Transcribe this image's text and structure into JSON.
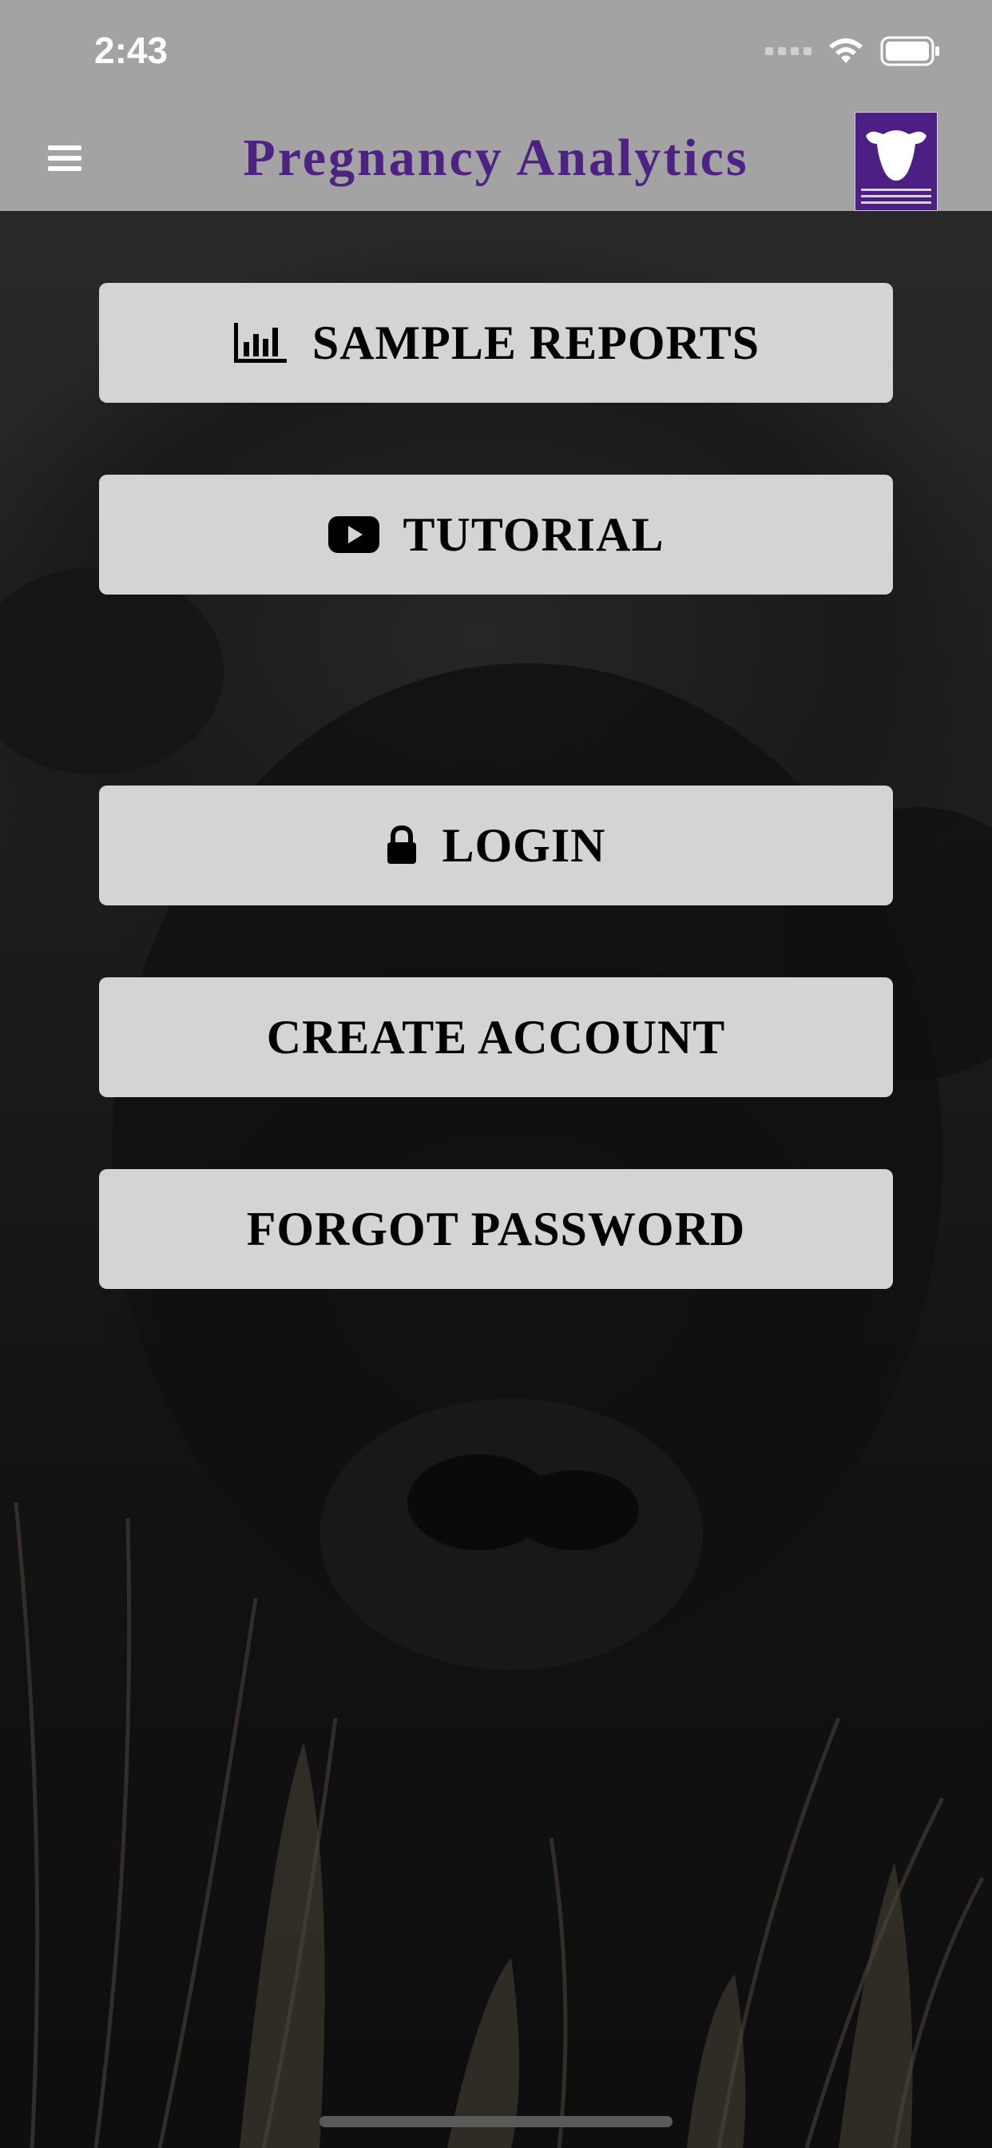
{
  "status_bar": {
    "time": "2:43"
  },
  "nav": {
    "title": "Pregnancy Analytics",
    "menu_icon": "hamburger-menu-icon",
    "logo_icon": "cow-head-logo"
  },
  "buttons": {
    "sample_reports": {
      "label": "SAMPLE REPORTS",
      "icon": "bar-chart-icon"
    },
    "tutorial": {
      "label": "TUTORIAL",
      "icon": "youtube-icon"
    },
    "login": {
      "label": "LOGIN",
      "icon": "lock-icon"
    },
    "create_account": {
      "label": "CREATE ACCOUNT"
    },
    "forgot_password": {
      "label": "FORGOT PASSWORD"
    }
  },
  "colors": {
    "bar_background": "#a3a3a3",
    "title": "#4e2283",
    "button_background": "#d4d4d4",
    "logo_background": "#4b1f84"
  }
}
